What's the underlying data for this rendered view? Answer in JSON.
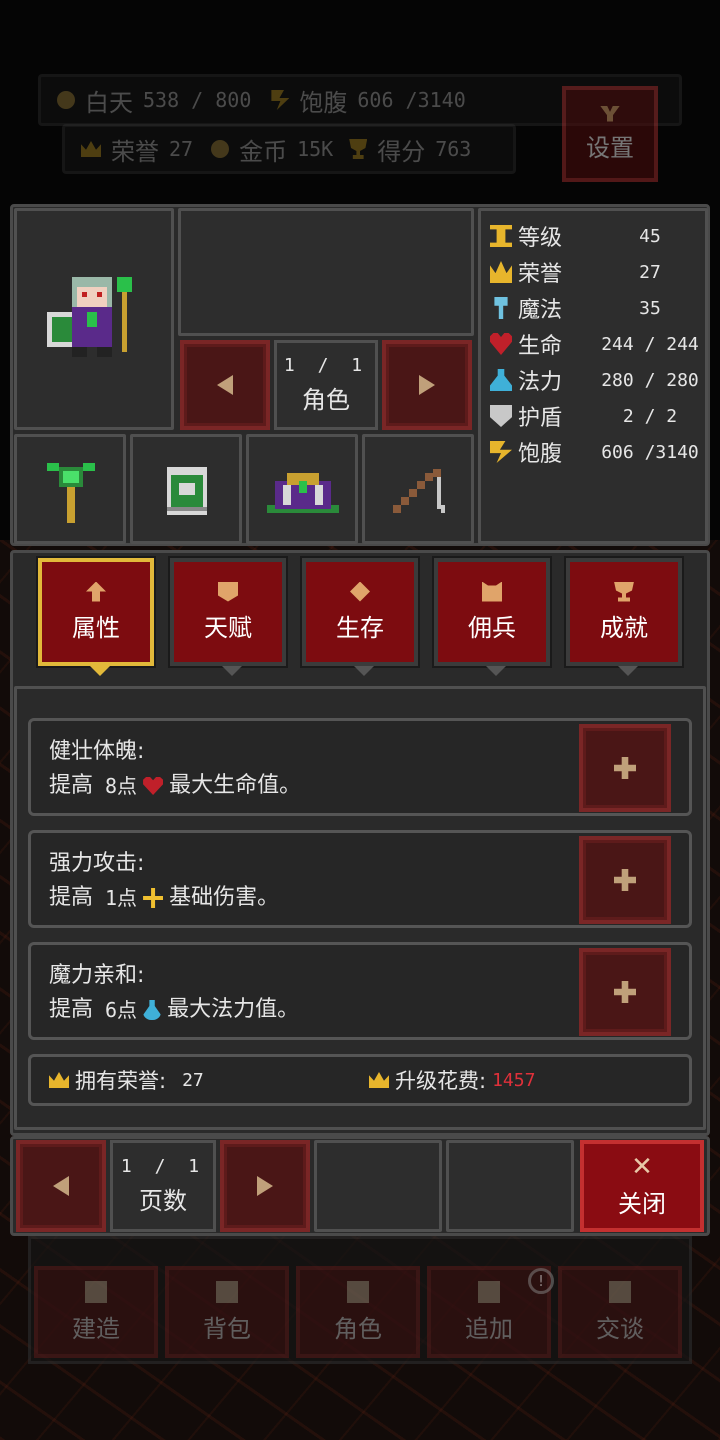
{
  "hud": {
    "day_label": "白天",
    "day_value": "538 / 800",
    "satiety_label": "饱腹",
    "satiety_value": "606 /3140",
    "honor_label": "荣誉",
    "honor_value": "27",
    "gold_label": "金币",
    "gold_value": "15K",
    "score_label": "得分",
    "score_value": "763",
    "settings_label": "设置"
  },
  "character": {
    "pager_num": "1 / 1",
    "pager_label": "角色",
    "equipment": [
      "staff-icon",
      "book-icon",
      "robe-icon",
      "fishing-rod-icon"
    ]
  },
  "stats": [
    {
      "icon": "level-icon",
      "name": "等级",
      "value": "45",
      "color": "#e7b52c"
    },
    {
      "icon": "crown-icon",
      "name": "荣誉",
      "value": "27",
      "color": "#e7b52c"
    },
    {
      "icon": "magic-icon",
      "name": "魔法",
      "value": "35",
      "color": "#6fc2e0"
    },
    {
      "icon": "heart-icon",
      "name": "生命",
      "value": "244 / 244",
      "color": "#c0202a"
    },
    {
      "icon": "flask-icon",
      "name": "法力",
      "value": "280 / 280",
      "color": "#3fb0d8"
    },
    {
      "icon": "shield-icon",
      "name": "护盾",
      "value": "2 / 2",
      "color": "#c8c8c8"
    },
    {
      "icon": "bolt-icon",
      "name": "饱腹",
      "value": "606 /3140",
      "color": "#e7b52c"
    }
  ],
  "tabs": [
    {
      "label": "属性",
      "active": true
    },
    {
      "label": "天赋",
      "active": false
    },
    {
      "label": "生存",
      "active": false
    },
    {
      "label": "佣兵",
      "active": false
    },
    {
      "label": "成就",
      "active": false
    }
  ],
  "perks": [
    {
      "title": "健壮体魄:",
      "prefix": "提高",
      "amount": "8点",
      "icon": "heart-icon",
      "suffix": "最大生命值。"
    },
    {
      "title": "强力攻击:",
      "prefix": "提高",
      "amount": "1点",
      "icon": "damage-icon",
      "suffix": "基础伤害。"
    },
    {
      "title": "魔力亲和:",
      "prefix": "提高",
      "amount": "6点",
      "icon": "flask-icon",
      "suffix": "最大法力值。"
    }
  ],
  "honor_bar": {
    "owned_label": "拥有荣誉:",
    "owned_value": "27",
    "cost_label": "升级花费:",
    "cost_value": "1457",
    "cost_color": "#e0303a"
  },
  "footer": {
    "pager_num": "1 / 1",
    "pager_label": "页数",
    "close_icon": "✕",
    "close_label": "关闭"
  },
  "bottom_nav": {
    "items": [
      "建造",
      "背包",
      "角色",
      "追加",
      "交谈"
    ],
    "badge": "!"
  }
}
